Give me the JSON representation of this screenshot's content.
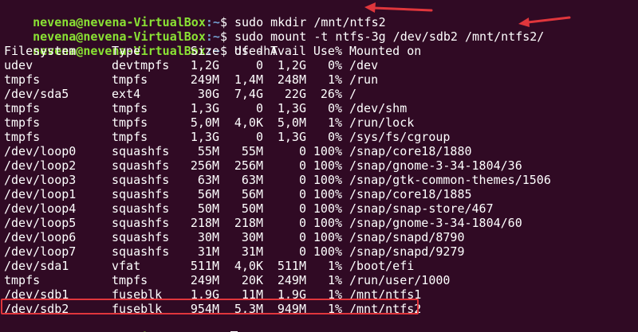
{
  "prompt": {
    "user_host": "nevena@nevena-VirtualBox",
    "path": ":~",
    "symbol": "$"
  },
  "commands": [
    "sudo mkdir /mnt/ntfs2",
    "sudo mount -t ntfs-3g /dev/sdb2 /mnt/ntfs2/",
    "df -hT"
  ],
  "df_table": {
    "headers": [
      "Filesystem",
      "Type",
      "Size",
      "Used",
      "Avail",
      "Use%",
      "Mounted on"
    ],
    "rows": [
      [
        "udev",
        "devtmpfs",
        "1,2G",
        "0",
        "1,2G",
        "0%",
        "/dev"
      ],
      [
        "tmpfs",
        "tmpfs",
        "249M",
        "1,4M",
        "248M",
        "1%",
        "/run"
      ],
      [
        "/dev/sda5",
        "ext4",
        "30G",
        "7,4G",
        "22G",
        "26%",
        "/"
      ],
      [
        "tmpfs",
        "tmpfs",
        "1,3G",
        "0",
        "1,3G",
        "0%",
        "/dev/shm"
      ],
      [
        "tmpfs",
        "tmpfs",
        "5,0M",
        "4,0K",
        "5,0M",
        "1%",
        "/run/lock"
      ],
      [
        "tmpfs",
        "tmpfs",
        "1,3G",
        "0",
        "1,3G",
        "0%",
        "/sys/fs/cgroup"
      ],
      [
        "/dev/loop0",
        "squashfs",
        "55M",
        "55M",
        "0",
        "100%",
        "/snap/core18/1880"
      ],
      [
        "/dev/loop2",
        "squashfs",
        "256M",
        "256M",
        "0",
        "100%",
        "/snap/gnome-3-34-1804/36"
      ],
      [
        "/dev/loop3",
        "squashfs",
        "63M",
        "63M",
        "0",
        "100%",
        "/snap/gtk-common-themes/1506"
      ],
      [
        "/dev/loop1",
        "squashfs",
        "56M",
        "56M",
        "0",
        "100%",
        "/snap/core18/1885"
      ],
      [
        "/dev/loop4",
        "squashfs",
        "50M",
        "50M",
        "0",
        "100%",
        "/snap/snap-store/467"
      ],
      [
        "/dev/loop5",
        "squashfs",
        "218M",
        "218M",
        "0",
        "100%",
        "/snap/gnome-3-34-1804/60"
      ],
      [
        "/dev/loop6",
        "squashfs",
        "30M",
        "30M",
        "0",
        "100%",
        "/snap/snapd/8790"
      ],
      [
        "/dev/loop7",
        "squashfs",
        "31M",
        "31M",
        "0",
        "100%",
        "/snap/snapd/9279"
      ],
      [
        "/dev/sda1",
        "vfat",
        "511M",
        "4,0K",
        "511M",
        "1%",
        "/boot/efi"
      ],
      [
        "tmpfs",
        "tmpfs",
        "249M",
        "20K",
        "249M",
        "1%",
        "/run/user/1000"
      ],
      [
        "/dev/sdb1",
        "fuseblk",
        "1,9G",
        "11M",
        "1,9G",
        "1%",
        "/mnt/ntfs1"
      ],
      [
        "/dev/sdb2",
        "fuseblk",
        "954M",
        "5,3M",
        "949M",
        "1%",
        "/mnt/ntfs2"
      ]
    ],
    "highlighted_row": 17
  },
  "colors": {
    "background": "#300a24",
    "prompt_user": "#8ae234",
    "prompt_path": "#729fcf",
    "text": "#ffffff",
    "annotation": "#e0363c"
  },
  "icons": {
    "arrows": "red-arrow-icon",
    "cursor": "block-cursor"
  }
}
